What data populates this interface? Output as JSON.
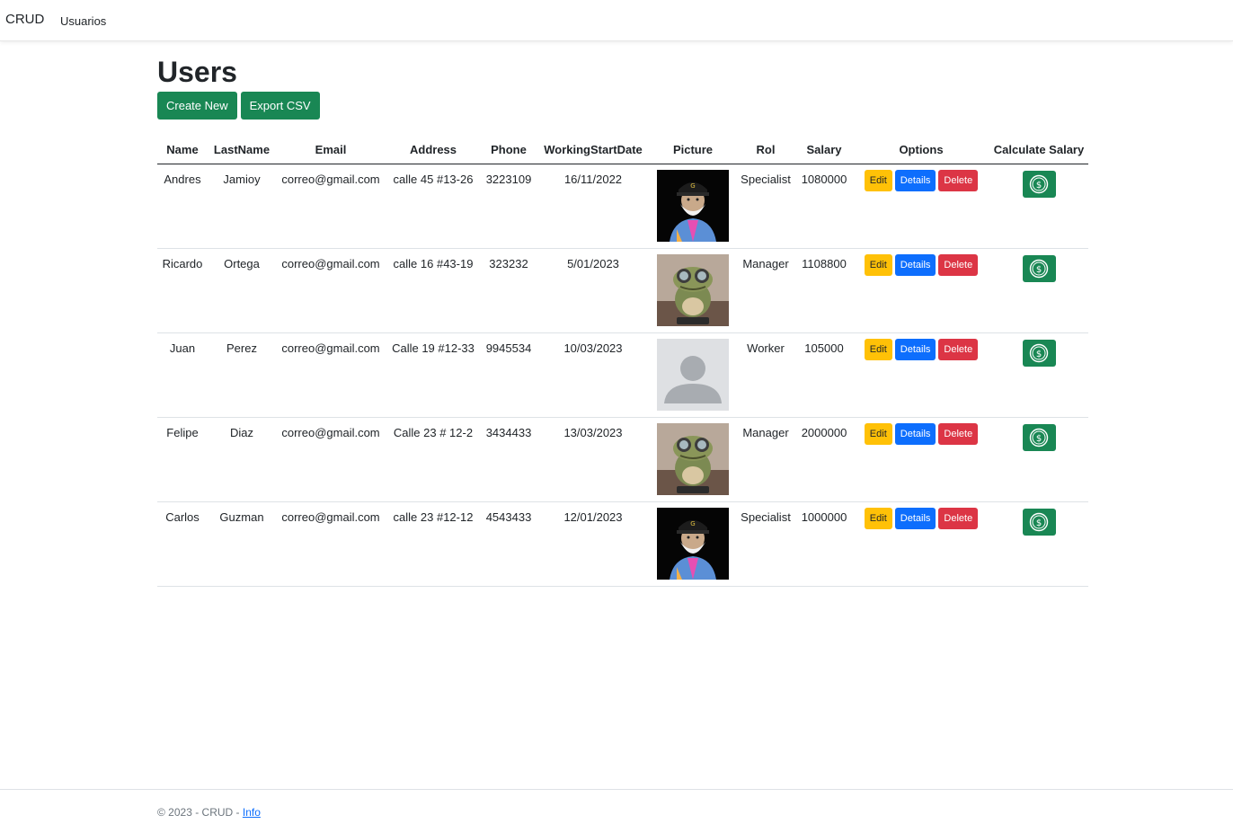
{
  "nav": {
    "brand": "CRUD",
    "link": "Usuarios"
  },
  "page": {
    "title": "Users"
  },
  "toolbar": {
    "create": "Create New",
    "export": "Export CSV"
  },
  "table": {
    "headers": [
      "Name",
      "LastName",
      "Email",
      "Address",
      "Phone",
      "WorkingStartDate",
      "Picture",
      "Rol",
      "Salary",
      "Options",
      "Calculate Salary"
    ],
    "buttons": {
      "edit": "Edit",
      "details": "Details",
      "delete": "Delete"
    },
    "rows": [
      {
        "name": "Andres",
        "lastname": "Jamioy",
        "email": "correo@gmail.com",
        "address": "calle 45 #13-26",
        "phone": "3223109",
        "date": "16/11/2022",
        "picture": "avatar-bearded-cap",
        "rol": "Specialist",
        "salary": "1080000"
      },
      {
        "name": "Ricardo",
        "lastname": "Ortega",
        "email": "correo@gmail.com",
        "address": "calle 16 #43-19",
        "phone": "323232",
        "date": "5/01/2023",
        "picture": "avatar-frog-goggles",
        "rol": "Manager",
        "salary": "1108800"
      },
      {
        "name": "Juan",
        "lastname": "Perez",
        "email": "correo@gmail.com",
        "address": "Calle 19 #12-33",
        "phone": "9945534",
        "date": "10/03/2023",
        "picture": "default-user-silhouette",
        "rol": "Worker",
        "salary": "105000"
      },
      {
        "name": "Felipe",
        "lastname": "Diaz",
        "email": "correo@gmail.com",
        "address": "Calle 23 # 12-2",
        "phone": "3434433",
        "date": "13/03/2023",
        "picture": "avatar-frog-goggles",
        "rol": "Manager",
        "salary": "2000000"
      },
      {
        "name": "Carlos",
        "lastname": "Guzman",
        "email": "correo@gmail.com",
        "address": "calle 23 #12-12",
        "phone": "4543433",
        "date": "12/01/2023",
        "picture": "avatar-bearded-cap",
        "rol": "Specialist",
        "salary": "1000000"
      }
    ]
  },
  "footer": {
    "text": "© 2023 - CRUD - ",
    "link": "Info"
  },
  "colors": {
    "primary": "#0d6efd",
    "success": "#198754",
    "warning": "#ffc107",
    "danger": "#dc3545"
  }
}
